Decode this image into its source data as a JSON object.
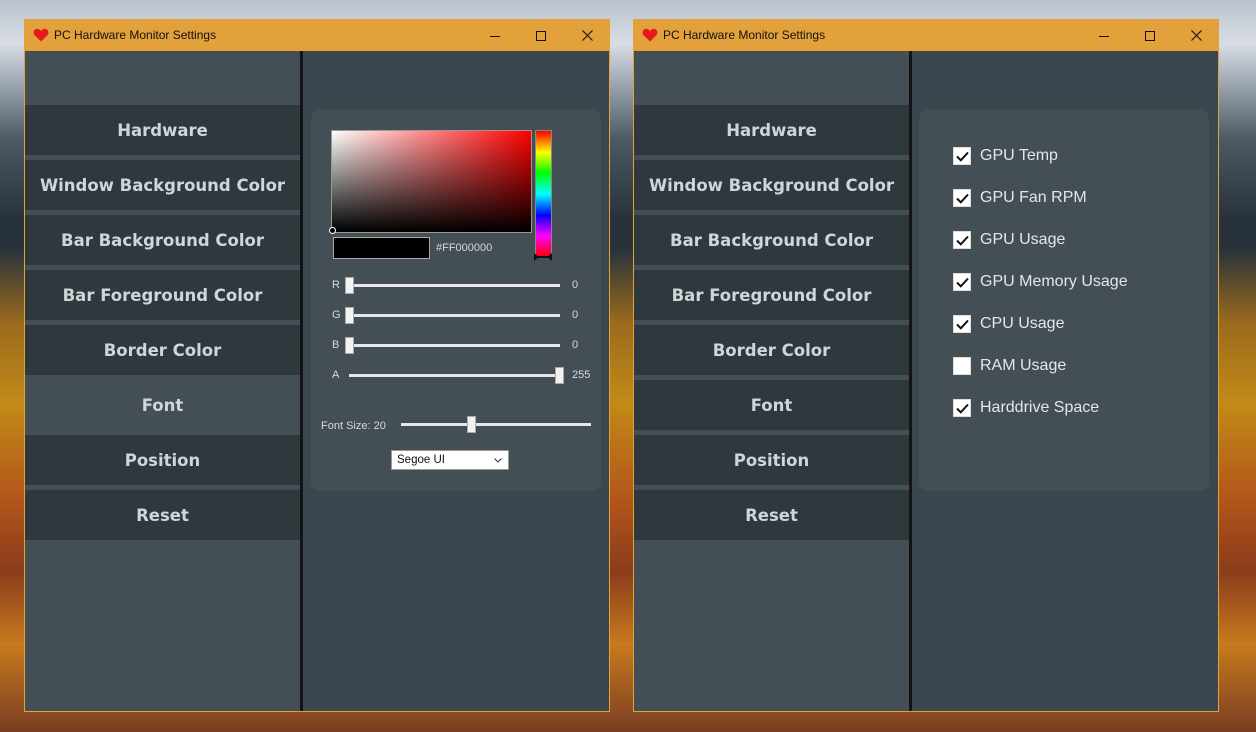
{
  "windows": [
    {
      "title": "PC Hardware Monitor Settings",
      "nav": [
        "Hardware",
        "Window Background Color",
        "Bar Background Color",
        "Bar Foreground Color",
        "Border Color",
        "Font",
        "Position",
        "Reset"
      ],
      "color_picker": {
        "hex_value": "#FF000000",
        "sliders": [
          {
            "label": "R",
            "value": "0"
          },
          {
            "label": "G",
            "value": "0"
          },
          {
            "label": "B",
            "value": "0"
          },
          {
            "label": "A",
            "value": "255"
          }
        ]
      },
      "font_size_label": "Font Size: 20",
      "font_select": "Segoe UI"
    },
    {
      "title": "PC Hardware Monitor Settings",
      "nav": [
        "Hardware",
        "Window Background Color",
        "Bar Background Color",
        "Bar Foreground Color",
        "Border Color",
        "Font",
        "Position",
        "Reset"
      ],
      "hardware": [
        {
          "label": "GPU Temp",
          "checked": true
        },
        {
          "label": "GPU Fan RPM",
          "checked": true
        },
        {
          "label": "GPU Usage",
          "checked": true
        },
        {
          "label": "GPU Memory Usage",
          "checked": true
        },
        {
          "label": "CPU Usage",
          "checked": true
        },
        {
          "label": "RAM Usage",
          "checked": false
        },
        {
          "label": "Harddrive Space",
          "checked": true
        }
      ]
    }
  ],
  "colors": {
    "titlebar": "#e2a13a",
    "content_bg": "#3a474e",
    "panel_bg": "#434f55",
    "nav_bg": "#2f383d"
  },
  "icons": {
    "app": "heart-icon",
    "minimize": "minimize-icon",
    "maximize": "maximize-icon",
    "close": "close-icon",
    "check": "check-icon"
  }
}
